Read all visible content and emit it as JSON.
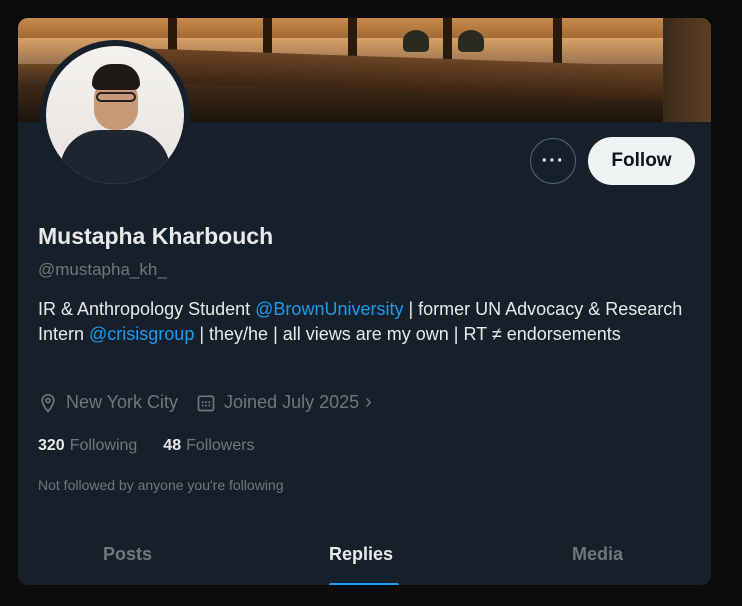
{
  "profile": {
    "name": "Mustapha Kharbouch",
    "handle": "@mustapha_kh_",
    "bio": {
      "part1": "IR & Anthropology Student ",
      "link1": "@BrownUniversity",
      "part2": " | former UN Advocacy & Research Intern ",
      "link2": "@crisisgroup",
      "part3": " | they/he | all views are my own | RT ≠ endorsements"
    },
    "location": "New York City",
    "joined": "Joined July 2025",
    "following_count": "320",
    "following_label": "Following",
    "followers_count": "48",
    "followers_label": "Followers",
    "not_followed_text": "Not followed by anyone you're following"
  },
  "actions": {
    "more_label": "···",
    "follow_label": "Follow"
  },
  "tabs": [
    {
      "label": "Posts"
    },
    {
      "label": "Replies"
    },
    {
      "label": "Media"
    }
  ],
  "icons": {
    "location": "map-pin-icon",
    "calendar": "calendar-icon",
    "chevron": "chevron-right-icon"
  },
  "colors": {
    "background": "#15202b",
    "accent": "#1d9bf0",
    "text_primary": "#e7e9ea",
    "text_secondary": "#71767b"
  }
}
